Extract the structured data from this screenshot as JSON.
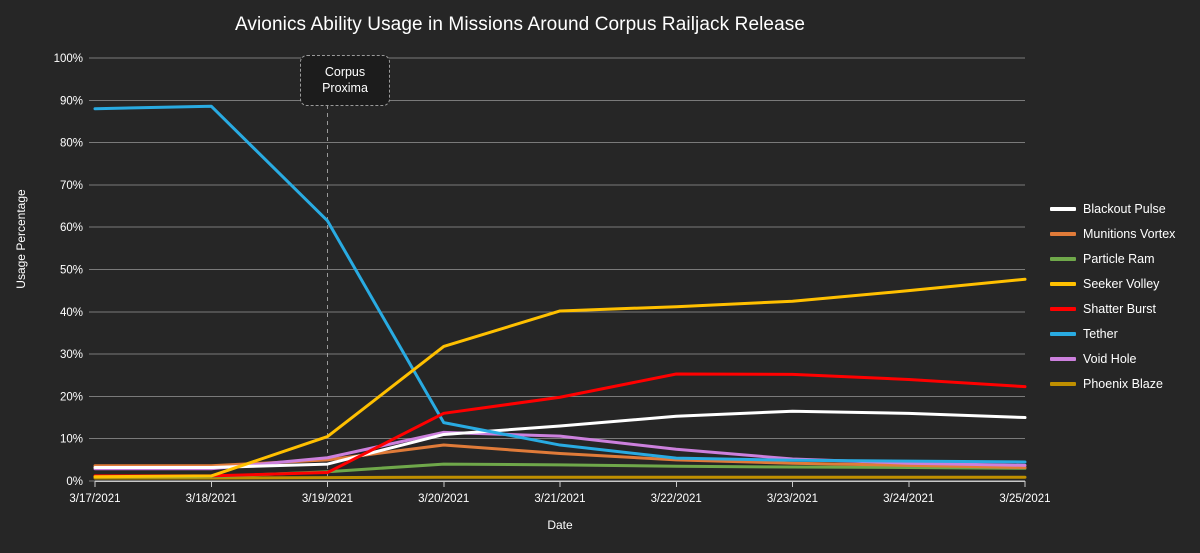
{
  "chart_data": {
    "type": "line",
    "title": "Avionics Ability Usage in Missions Around Corpus Railjack Release",
    "xlabel": "Date",
    "ylabel": "Usage Percentage",
    "categories": [
      "3/17/2021",
      "3/18/2021",
      "3/19/2021",
      "3/20/2021",
      "3/21/2021",
      "3/22/2021",
      "3/23/2021",
      "3/24/2021",
      "3/25/2021"
    ],
    "ylim": [
      0,
      100
    ],
    "yticks": [
      "0%",
      "10%",
      "20%",
      "30%",
      "40%",
      "50%",
      "60%",
      "70%",
      "80%",
      "90%",
      "100%"
    ],
    "grid": true,
    "legend_position": "right",
    "annotations": [
      {
        "label": "Corpus\nProxima",
        "line1": "Corpus",
        "line2": "Proxima",
        "x_category": "3/19/2021",
        "style": "dashed-vertical-line"
      }
    ],
    "series": [
      {
        "name": "Blackout Pulse",
        "color": "#FFFFFF",
        "values": [
          3.2,
          3.2,
          4.0,
          11.0,
          13.0,
          15.3,
          16.5,
          16.0,
          15.0
        ]
      },
      {
        "name": "Munitions Vortex",
        "color": "#E07B39",
        "values": [
          3.6,
          3.6,
          5.0,
          8.5,
          6.5,
          5.0,
          4.2,
          3.7,
          3.2
        ]
      },
      {
        "name": "Particle Ram",
        "color": "#6FA84A",
        "values": [
          1.0,
          1.0,
          2.2,
          4.0,
          3.8,
          3.5,
          3.3,
          3.2,
          3.0
        ]
      },
      {
        "name": "Seeker Volley",
        "color": "#FFC000",
        "values": [
          1.0,
          1.2,
          10.5,
          31.8,
          40.2,
          41.2,
          42.5,
          45.0,
          47.7
        ]
      },
      {
        "name": "Shatter Burst",
        "color": "#FF0000",
        "values": [
          1.2,
          1.2,
          2.0,
          16.0,
          19.8,
          25.3,
          25.2,
          24.0,
          22.3
        ]
      },
      {
        "name": "Tether",
        "color": "#29ABE2",
        "values": [
          88.0,
          88.6,
          61.5,
          13.8,
          8.5,
          5.4,
          4.9,
          4.7,
          4.5
        ]
      },
      {
        "name": "Void Hole",
        "color": "#CC80DD",
        "values": [
          2.9,
          2.9,
          5.5,
          11.5,
          10.6,
          7.5,
          5.2,
          4.2,
          3.7
        ]
      },
      {
        "name": "Phoenix Blaze",
        "color": "#BF8F00",
        "values": [
          0.7,
          0.7,
          0.8,
          0.9,
          0.9,
          0.9,
          0.9,
          0.9,
          0.9
        ]
      }
    ]
  },
  "legend": {
    "items": [
      {
        "label": "Blackout Pulse",
        "color": "#FFFFFF"
      },
      {
        "label": "Munitions Vortex",
        "color": "#E07B39"
      },
      {
        "label": "Particle Ram",
        "color": "#6FA84A"
      },
      {
        "label": "Seeker Volley",
        "color": "#FFC000"
      },
      {
        "label": "Shatter Burst",
        "color": "#FF0000"
      },
      {
        "label": "Tether",
        "color": "#29ABE2"
      },
      {
        "label": "Void Hole",
        "color": "#CC80DD"
      },
      {
        "label": "Phoenix Blaze",
        "color": "#BF8F00"
      }
    ]
  },
  "theme": {
    "background": "#262626",
    "grid_color": "#7a7a7a",
    "text_color": "#FFFFFF",
    "annotation_bg": "#1c1c1c",
    "annotation_border": "#9a9a9a"
  }
}
